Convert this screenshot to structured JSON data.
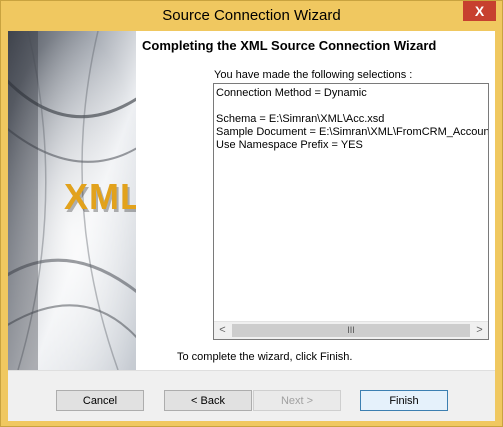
{
  "window": {
    "title": "Source Connection Wizard",
    "close_label": "X"
  },
  "side_panel": {
    "logo_text": "XML"
  },
  "content": {
    "heading": "Completing the XML Source Connection Wizard",
    "selections_label": "You have made the following selections :",
    "selections_text": "Connection Method = Dynamic\n\nSchema = E:\\Simran\\XML\\Acc.xsd\nSample Document = E:\\Simran\\XML\\FromCRM_Account\nUse Namespace Prefix = YES",
    "scroll_left": "<",
    "scroll_right": ">",
    "scroll_grip": "III",
    "finish_hint": "To complete the wizard, click Finish."
  },
  "buttons": {
    "cancel": "Cancel",
    "back": "< Back",
    "next": "Next >",
    "finish": "Finish"
  }
}
